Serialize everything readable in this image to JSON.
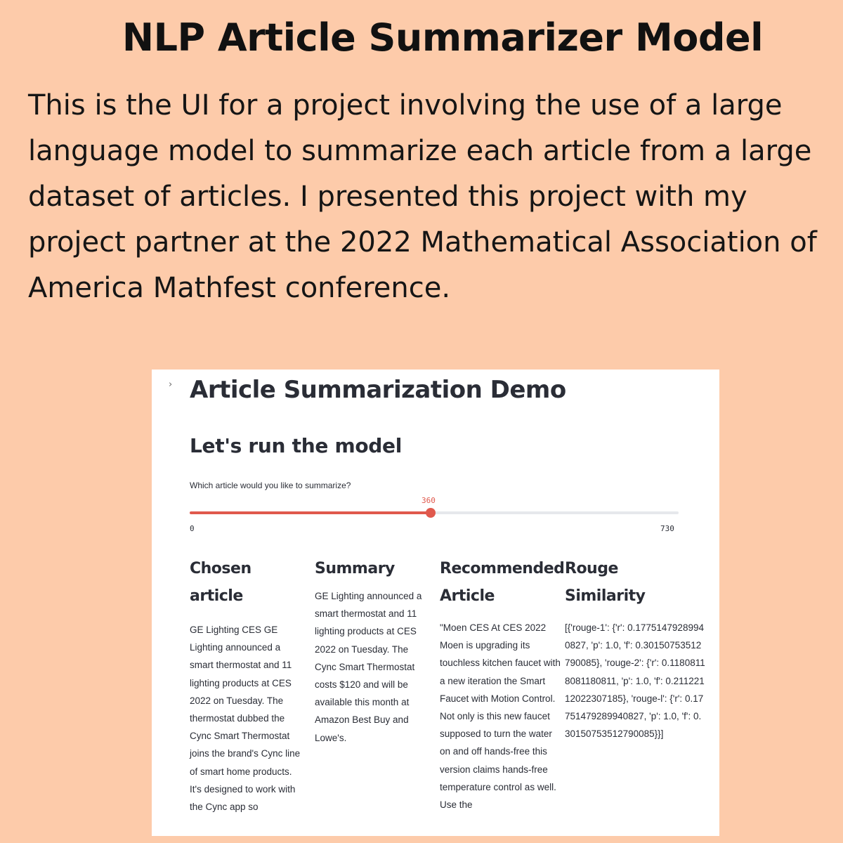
{
  "poster": {
    "title": "NLP Article Summarizer Model",
    "description": "This is the UI for a project involving the use of a large language model to summarize each article from a large dataset of articles. I presented this project with my project partner at the 2022 Mathematical Association of America Mathfest conference."
  },
  "app": {
    "sidebar_toggle_icon": "chevron-right-icon",
    "title": "Article Summarization Demo",
    "section_heading": "Let's run the model",
    "slider": {
      "label": "Which article would you like to summarize?",
      "value": 360,
      "value_label": "360",
      "min": 0,
      "min_label": "0",
      "max": 730,
      "max_label": "730",
      "accent_color": "#e0594d"
    },
    "columns": {
      "article": {
        "heading": "Chosen\narticle",
        "text": "GE Lighting CES GE Lighting announced a smart thermostat and 11 lighting products at CES 2022 on Tuesday. The thermostat dubbed the Cync Smart Thermostat joins the brand's Cync line of smart home products. It's designed to work with the Cync app so"
      },
      "summary": {
        "heading": "Summary",
        "text": "GE Lighting announced a smart thermostat and 11 lighting products at CES 2022 on Tuesday. The Cync Smart Thermostat costs $120 and will be available this month at Amazon Best Buy and Lowe's."
      },
      "recommended": {
        "heading": "Recommended\nArticle",
        "text": "\"Moen CES At CES 2022 Moen is upgrading its touchless kitchen faucet with a new iteration the Smart Faucet with Motion Control. Not only is this new faucet supposed to turn the water on and off hands-free this version claims hands-free temperature control as well. Use the"
      },
      "rouge": {
        "heading": "Rouge\nSimilarity",
        "text": "[{'rouge-1': {'r': 0.17751479289940827, 'p': 1.0, 'f': 0.30150753512790085}, 'rouge-2': {'r': 0.11808118081180811, 'p': 1.0, 'f': 0.21122112022307185}, 'rouge-l': {'r': 0.17751479289940827, 'p': 1.0, 'f': 0.30150753512790085}}]"
      }
    }
  }
}
